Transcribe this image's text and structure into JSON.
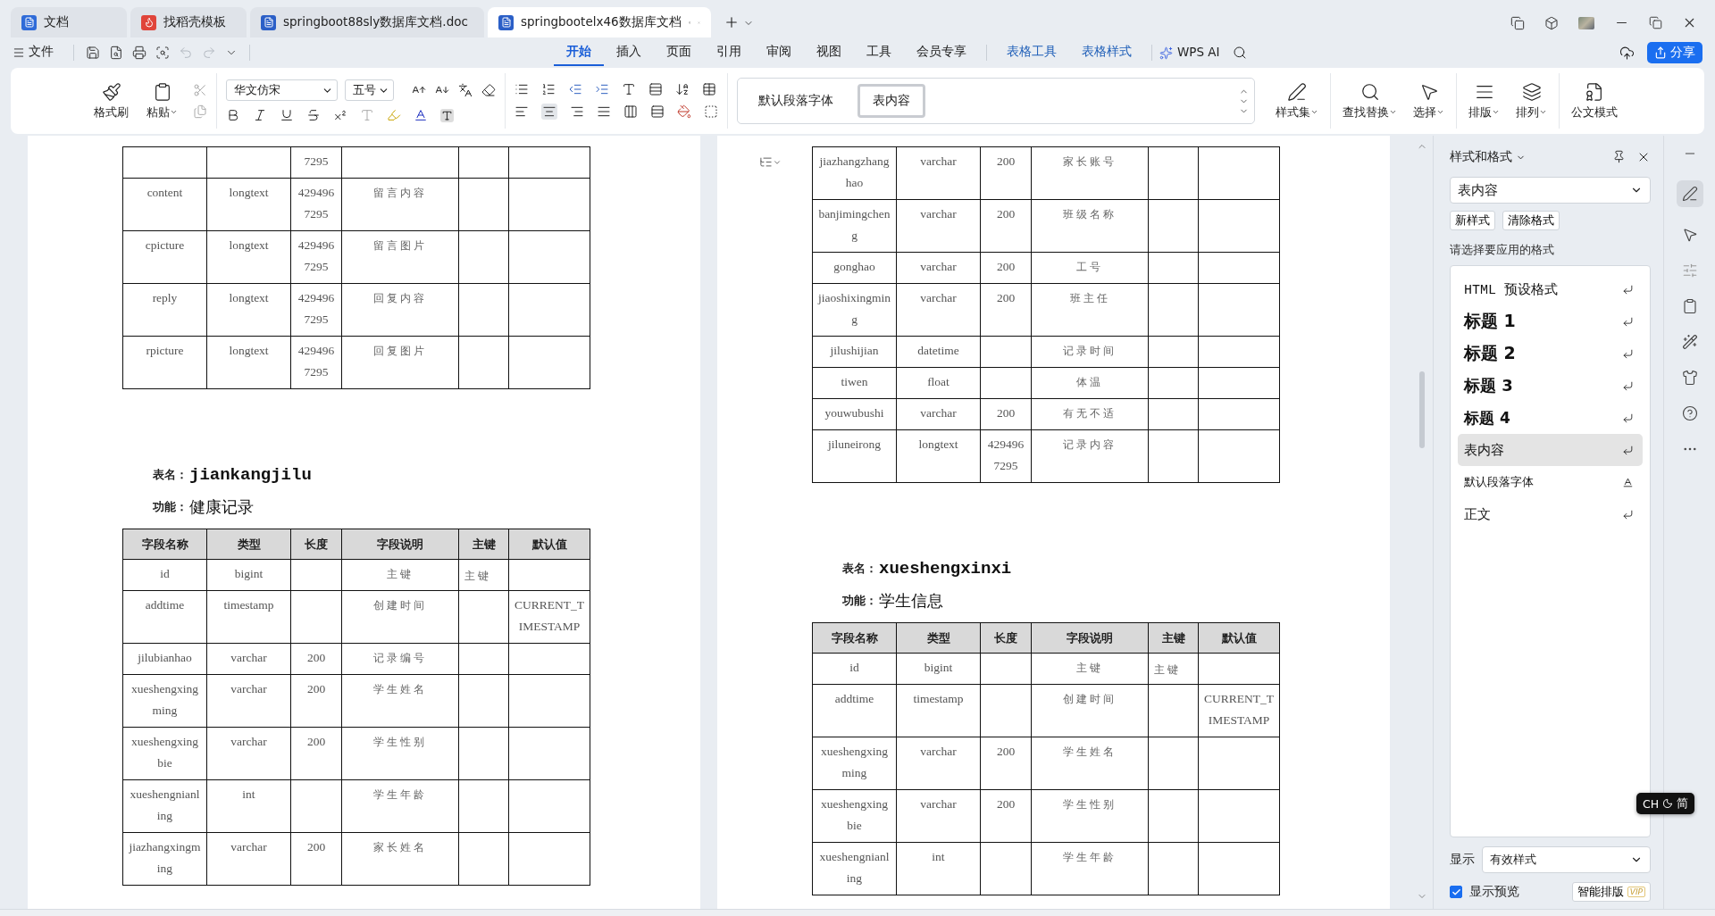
{
  "tabs": [
    {
      "label": "文档",
      "kind": "docs",
      "selected": false
    },
    {
      "label": "找稻壳模板",
      "kind": "template",
      "selected": false
    },
    {
      "label": "springboot88sly数据库文档.doc",
      "kind": "word",
      "selected": false
    },
    {
      "label": "springbootelx46数据库文档",
      "kind": "word",
      "selected": true
    }
  ],
  "menu": {
    "file": "文件",
    "items": [
      {
        "label": "开始",
        "kind": "main",
        "selected": true
      },
      {
        "label": "插入",
        "kind": "main",
        "selected": false
      },
      {
        "label": "页面",
        "kind": "main",
        "selected": false
      },
      {
        "label": "引用",
        "kind": "main",
        "selected": false
      },
      {
        "label": "审阅",
        "kind": "main",
        "selected": false
      },
      {
        "label": "视图",
        "kind": "main",
        "selected": false
      },
      {
        "label": "工具",
        "kind": "main",
        "selected": false
      },
      {
        "label": "会员专享",
        "kind": "main",
        "selected": false
      },
      {
        "label": "表格工具",
        "kind": "context",
        "selected": false
      },
      {
        "label": "表格样式",
        "kind": "context",
        "selected": false
      }
    ],
    "ai": "WPS AI",
    "share": "分享"
  },
  "ribbon": {
    "format_painter": "格式刷",
    "paste": "粘贴",
    "font": "华文仿宋",
    "size": "五号",
    "style_gallery": [
      {
        "label": "默认段落字体",
        "selected": false
      },
      {
        "label": "表内容",
        "selected": true
      }
    ],
    "style_set": "样式集",
    "find_replace": "查找替换",
    "select": "选择",
    "layout": "排版",
    "arrange": "排列",
    "official_mode": "公文模式"
  },
  "pages": [
    {
      "blocks": [
        {
          "kind": "table",
          "rows": [
            [
              null,
              null,
              "7295",
              null,
              null,
              null
            ],
            [
              "content",
              "longtext",
              "4294967295",
              "留言内容",
              null,
              null
            ],
            [
              "cpicture",
              "longtext",
              "4294967295",
              "留言图片",
              null,
              null
            ],
            [
              "reply",
              "longtext",
              "4294967295",
              "回复内容",
              null,
              null
            ],
            [
              "rpicture",
              "longtext",
              "4294967295",
              "回复图片",
              null,
              null
            ]
          ]
        },
        {
          "kind": "heading",
          "name_label": "表名：",
          "name": "jiankangjilu",
          "func_label": "功能：",
          "func": "健康记录"
        },
        {
          "kind": "table",
          "header": [
            "字段名称",
            "类型",
            "长度",
            "字段说明",
            "主键",
            "默认值"
          ],
          "rows": [
            [
              "id",
              "bigint",
              null,
              "主键",
              "主键",
              null
            ],
            [
              "addtime",
              "timestamp",
              null,
              "创建时间",
              null,
              "CURRENT_TIMESTAMP"
            ],
            [
              "jilubianhao",
              "varchar",
              "200",
              "记录编号",
              null,
              null
            ],
            [
              "xueshengxingming",
              "varchar",
              "200",
              "学生姓名",
              null,
              null
            ],
            [
              "xueshengxingbie",
              "varchar",
              "200",
              "学生性别",
              null,
              null
            ],
            [
              "xueshengnianling",
              "int",
              null,
              "学生年龄",
              null,
              null
            ],
            [
              "jiazhangxingming",
              "varchar",
              "200",
              "家长姓名",
              null,
              null
            ]
          ]
        }
      ]
    },
    {
      "blocks": [
        {
          "kind": "table",
          "rows": [
            [
              "jiazhangzhanghao",
              "varchar",
              "200",
              "家长账号",
              null,
              null
            ],
            [
              "banjimingcheng",
              "varchar",
              "200",
              "班级名称",
              null,
              null
            ],
            [
              "gonghao",
              "varchar",
              "200",
              "工号",
              null,
              null
            ],
            [
              "jiaoshixingming",
              "varchar",
              "200",
              "班主任",
              null,
              null
            ],
            [
              "jilushijian",
              "datetime",
              null,
              "记录时间",
              null,
              null
            ],
            [
              "tiwen",
              "float",
              null,
              "体温",
              null,
              null
            ],
            [
              "youwubushi",
              "varchar",
              "200",
              "有无不适",
              null,
              null
            ],
            [
              "jiluneirong",
              "longtext",
              "4294967295",
              "记录内容",
              null,
              null
            ]
          ]
        },
        {
          "kind": "heading",
          "name_label": "表名：",
          "name": "xueshengxinxi",
          "func_label": "功能：",
          "func": "学生信息"
        },
        {
          "kind": "table",
          "header": [
            "字段名称",
            "类型",
            "长度",
            "字段说明",
            "主键",
            "默认值"
          ],
          "rows": [
            [
              "id",
              "bigint",
              null,
              "主键",
              "主键",
              null
            ],
            [
              "addtime",
              "timestamp",
              null,
              "创建时间",
              null,
              "CURRENT_TIMESTAMP"
            ],
            [
              "xueshengxingming",
              "varchar",
              "200",
              "学生姓名",
              null,
              null
            ],
            [
              "xueshengxingbie",
              "varchar",
              "200",
              "学生性别",
              null,
              null
            ],
            [
              "xueshengnianling",
              "int",
              null,
              "学生年龄",
              null,
              null
            ]
          ]
        }
      ]
    }
  ],
  "styles_panel": {
    "title": "样式和格式",
    "current": "表内容",
    "new_style": "新样式",
    "clear_format": "清除格式",
    "prompt": "请选择要应用的格式",
    "items": [
      {
        "label": "HTML 预设格式",
        "kind": "pre",
        "selected": false
      },
      {
        "label": "标题 1",
        "kind": "h1",
        "selected": false
      },
      {
        "label": "标题 2",
        "kind": "h2",
        "selected": false
      },
      {
        "label": "标题 3",
        "kind": "h3",
        "selected": false
      },
      {
        "label": "标题 4",
        "kind": "h4",
        "selected": false
      },
      {
        "label": "表内容",
        "kind": "para",
        "selected": true
      },
      {
        "label": "默认段落字体",
        "kind": "char",
        "selected": false
      },
      {
        "label": "正文",
        "kind": "para",
        "selected": false
      }
    ],
    "show_label": "显示",
    "show_value": "有效样式",
    "preview_label": "显示预览",
    "preview_checked": true,
    "smart_layout": "智能排版",
    "vip": "VIP"
  },
  "ime": {
    "language": "CH",
    "mode": "简"
  }
}
